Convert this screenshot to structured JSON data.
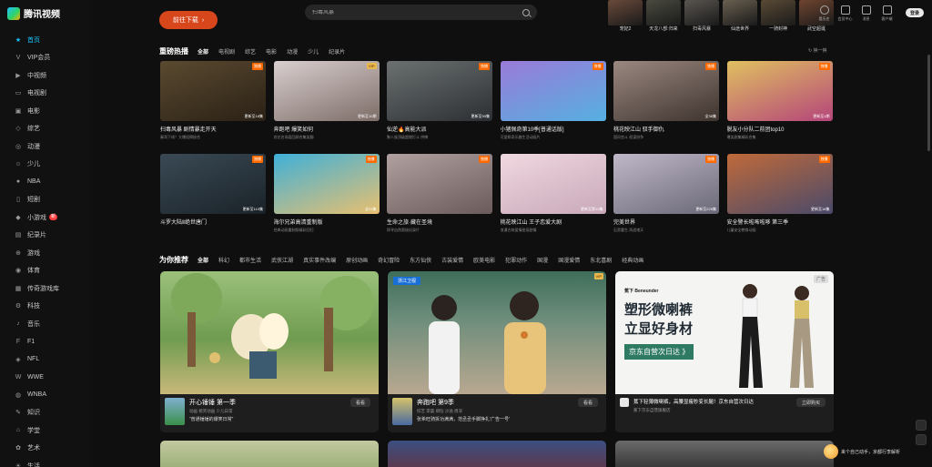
{
  "app": {
    "logo_text": "腾讯视频"
  },
  "sidebar": {
    "items": [
      {
        "label": "首页",
        "icon": "star-icon",
        "active": true
      },
      {
        "label": "VIP会员",
        "icon": "vip-icon"
      },
      {
        "label": "中视频",
        "icon": "play-icon"
      },
      {
        "label": "电视剧",
        "icon": "tv-icon"
      },
      {
        "label": "电影",
        "icon": "film-icon"
      },
      {
        "label": "综艺",
        "icon": "variety-icon"
      },
      {
        "label": "动漫",
        "icon": "anime-icon"
      },
      {
        "label": "少儿",
        "icon": "kids-icon"
      },
      {
        "label": "NBA",
        "icon": "basketball-icon"
      },
      {
        "label": "短剧",
        "icon": "short-drama-icon"
      },
      {
        "label": "小游戏",
        "icon": "game-icon",
        "badge": "新"
      },
      {
        "label": "纪录片",
        "icon": "doc-icon"
      },
      {
        "label": "游戏",
        "icon": "gamepad-icon"
      },
      {
        "label": "体育",
        "icon": "sports-icon"
      },
      {
        "label": "传奇游戏库",
        "icon": "library-icon"
      },
      {
        "label": "科技",
        "icon": "tech-icon"
      },
      {
        "label": "音乐",
        "icon": "music-icon"
      },
      {
        "label": "F1",
        "icon": "f1-icon"
      },
      {
        "label": "NFL",
        "icon": "nfl-icon"
      },
      {
        "label": "WWE",
        "icon": "wwe-icon"
      },
      {
        "label": "WNBA",
        "icon": "wnba-icon"
      },
      {
        "label": "知识",
        "icon": "knowledge-icon"
      },
      {
        "label": "学堂",
        "icon": "school-icon"
      },
      {
        "label": "艺术",
        "icon": "art-icon"
      },
      {
        "label": "生活",
        "icon": "life-icon"
      }
    ]
  },
  "topbar": {
    "download_label": "前往下载",
    "search_placeholder": "扫毒风暴",
    "hero_items": [
      {
        "caption": "宠妃2",
        "color": "#6a4a3a"
      },
      {
        "caption": "天龙八部:归来",
        "color": "#4a4a40"
      },
      {
        "caption": "扫毒风暴",
        "color": "#5a5550"
      },
      {
        "caption": "仙途世界",
        "color": "#6a6050"
      },
      {
        "caption": "一骑封神",
        "color": "#5a4a35"
      },
      {
        "caption": "武空超诞",
        "color": "#704530"
      }
    ],
    "tools": [
      {
        "label": "看历史",
        "icon": "history-icon"
      },
      {
        "label": "会员中心",
        "icon": "vip-center-icon"
      },
      {
        "label": "消息",
        "icon": "message-icon"
      },
      {
        "label": "客户端",
        "icon": "client-icon"
      }
    ],
    "login_label": "登录"
  },
  "hot": {
    "title": "重磅热播",
    "tabs": [
      "全部",
      "电视剧",
      "综艺",
      "电影",
      "动漫",
      "少儿",
      "纪录片"
    ],
    "refresh_label": "换一换",
    "cards": [
      {
        "title": "扫毒风暴 剧情暴走开天",
        "sub": "秦哥下线？大爆组揭秘合",
        "tag": "独播",
        "upd": "更新至18集",
        "c1": "#5a4a30",
        "c2": "#2a2015"
      },
      {
        "title": "奔跑吧 爆笑如何",
        "sub": "综艺名场面回顾合集笑翻",
        "tag": "VIP",
        "upd": "更新至10期",
        "c1": "#d9cfcf",
        "c2": "#7d6d68"
      },
      {
        "title": "仙逆🔥高能大派",
        "sub": "聚人族顶级超燃打斗 拼搏",
        "tag": "独播",
        "upd": "更新至90集",
        "c1": "#6b7070",
        "c2": "#2b2f33"
      },
      {
        "title": "小猪佩奇第10季[普通话版]",
        "sub": "可爱佩奇乐趣生活动画片",
        "tag": "独播",
        "upd": "",
        "c1": "#9a7ad8",
        "c2": "#55b0e0"
      },
      {
        "title": "桃花映江山 驭手御仇",
        "sub": "国风宫斗 权谋纷争",
        "tag": "独播",
        "upd": "全36集",
        "c1": "#9a8880",
        "c2": "#3e332e"
      },
      {
        "title": "脱友小分队二前团top10",
        "sub": "爆笑剧集精彩合集",
        "tag": "独播",
        "upd": "更新至4期",
        "c1": "#e0c060",
        "c2": "#b5457a"
      },
      {
        "title": "斗罗大陆Ⅱ绝世唐门",
        "sub": "",
        "tag": "独播",
        "upd": "更新至110集",
        "c1": "#3a4a55",
        "c2": "#1a2228"
      },
      {
        "title": "海尔兄弟高清重制版",
        "sub": "经典动画重制版精彩回归",
        "tag": "独播",
        "upd": "全31集",
        "c1": "#3fb0d8",
        "c2": "#e8c070"
      },
      {
        "title": "生命之旅·藏在圣境",
        "sub": "探寻自然奥秘纪录片",
        "tag": "独播",
        "upd": "",
        "c1": "#b0a0a0",
        "c2": "#6a5a5a"
      },
      {
        "title": "桃花映江山 王子恋爱大剧",
        "sub": "浪漫古装爱情甜宠剧情",
        "tag": "",
        "upd": "更新至第13集",
        "c1": "#f0d8e0",
        "c2": "#c8a8b8"
      },
      {
        "title": "完美世界",
        "sub": "石昊重生 再战诸天",
        "tag": "独播",
        "upd": "更新至225集",
        "c1": "#c0b8c8",
        "c2": "#6a6878"
      },
      {
        "title": "安全警长啦咘啦哆 第三季",
        "sub": "儿童安全教育动画",
        "tag": "独播",
        "upd": "更新至18集",
        "c1": "#c06a3a",
        "c2": "#4a4a6a"
      }
    ]
  },
  "recommend": {
    "title": "为你推荐",
    "tabs": [
      "全部",
      "科幻",
      "都市生活",
      "武侠江湖",
      "真实事件改编",
      "原创动画",
      "奇幻冒险",
      "东方仙侠",
      "古装爱情",
      "欧美电影",
      "犯罪动作",
      "国漫",
      "国漫爱情",
      "东北喜剧",
      "经典动画"
    ],
    "cards": [
      {
        "title": "开心锤锤 第一季",
        "sub": "动画 搞笑动画 少儿日常",
        "desc": "“普通锤锤的爆笑日常”",
        "follow": "看看",
        "tag": ""
      },
      {
        "title": "奔跑吧 第9季",
        "sub": "综艺 李晨 郑恺 沙溢 周深",
        "desc": "张希旺骑拆功满满，范丞丞手脚挣扎'广告一号'",
        "follow": "看看",
        "tag": "VIP",
        "logo": "浙江卫视"
      },
      {
        "title": "蕉下轻薄微喇裤，高腰显瘦秒变长腿！京东自营次日达",
        "sub": "蕉下京东自营旗舰店",
        "follow": "立即购买",
        "ad": true
      }
    ],
    "ad": {
      "brand": "蕉下 Beneunder",
      "headline_1": "塑形微喇裤",
      "headline_2": "立显好身材",
      "chip": "京东自营次日达 》",
      "corner": "广告"
    }
  },
  "assistant": {
    "label": "来个自己动手，京都行李解析"
  },
  "colors": {
    "accent": "#19c6ff",
    "download": "#d8471c",
    "tag_exclusive": "#ff6a00",
    "tag_vip": "#e9b74e"
  }
}
